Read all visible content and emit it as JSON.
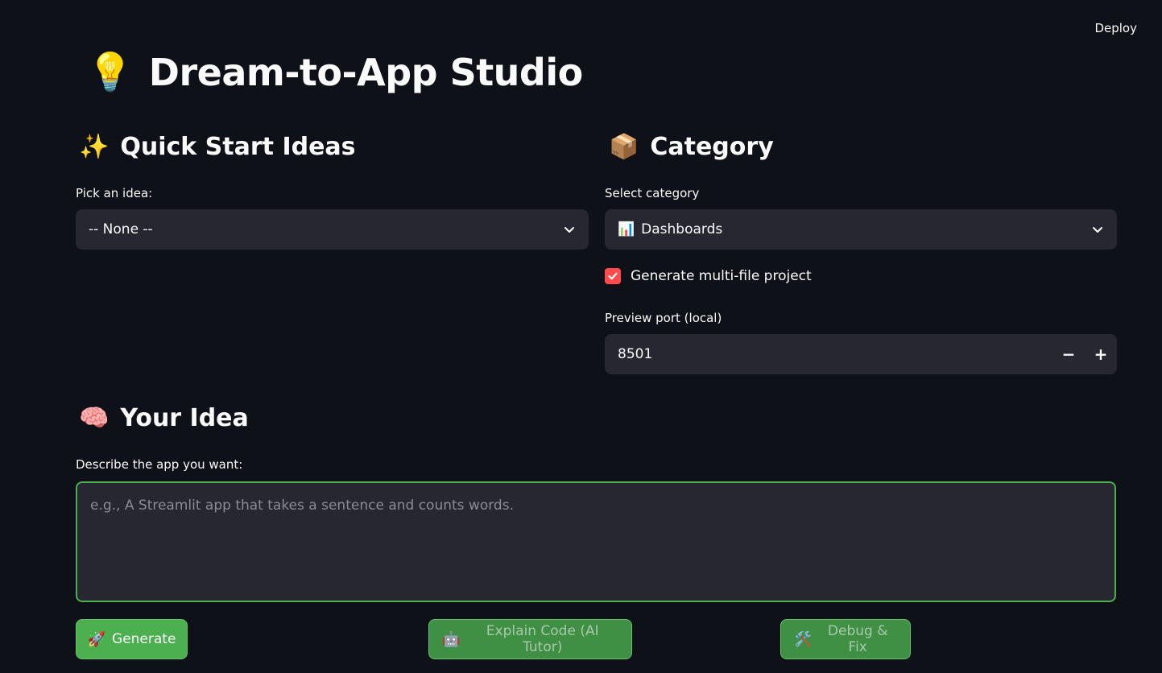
{
  "header": {
    "deploy_label": "Deploy"
  },
  "title": {
    "icon": "light-bulb-icon",
    "emoji": "💡",
    "text": "Dream-to-App Studio"
  },
  "quick_start": {
    "emoji": "✨",
    "heading": "Quick Start Ideas",
    "label": "Pick an idea:",
    "selected": "-- None --"
  },
  "category": {
    "emoji": "📦",
    "heading": "Category",
    "label": "Select category",
    "selected_emoji": "📊",
    "selected": "Dashboards",
    "multi_file_label": "Generate multi-file project",
    "multi_file_checked": true,
    "port_label": "Preview port (local)",
    "port_value": "8501",
    "minus": "−",
    "plus": "+"
  },
  "your_idea": {
    "emoji": "🧠",
    "heading": "Your Idea",
    "label": "Describe the app you want:",
    "placeholder": "e.g., A Streamlit app that takes a sentence and counts words.",
    "value": ""
  },
  "actions": {
    "generate_emoji": "🚀",
    "generate_label": "Generate",
    "explain_emoji": "🤖",
    "explain_label": "Explain Code (AI Tutor)",
    "debug_emoji": "🛠️",
    "debug_label": "Debug & Fix"
  },
  "colors": {
    "background": "#0e1117",
    "input_bg": "#262730",
    "accent_red": "#ff4b4b",
    "accent_green": "#4caf50"
  }
}
